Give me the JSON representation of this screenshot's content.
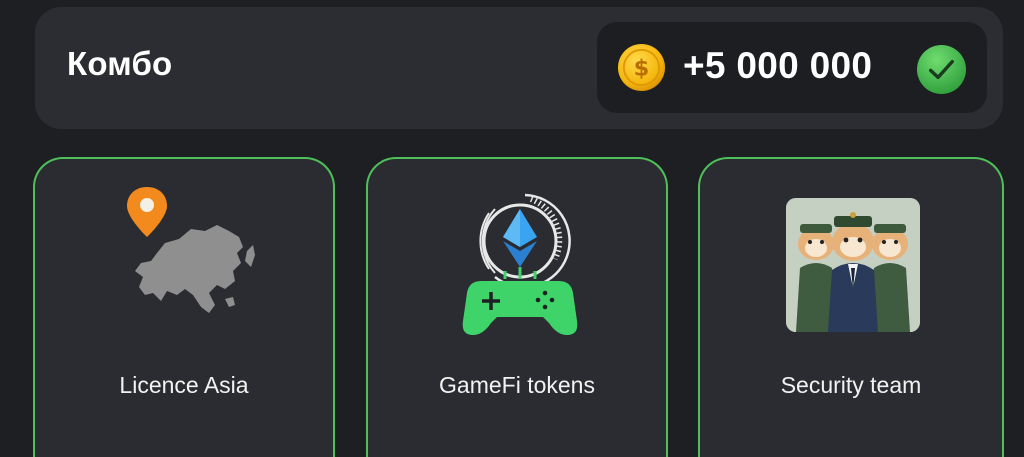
{
  "combo": {
    "title": "Комбо",
    "reward_amount": "+5 000 000",
    "coin_icon": "dollar-coin-icon",
    "status_icon": "check-circle-icon",
    "completed": true
  },
  "cards": [
    {
      "label": "Licence Asia",
      "icon": "asia-map-pin-icon"
    },
    {
      "label": "GameFi tokens",
      "icon": "ethereum-gamepad-icon"
    },
    {
      "label": "Security team",
      "icon": "hamster-guards-image"
    }
  ],
  "colors": {
    "background": "#1d1f22",
    "panel": "#2b2d32",
    "reward_box": "#1c1e21",
    "card_border": "#4fbf5a",
    "coin": "#f5b70f",
    "check": "#3fb64b",
    "gamepad": "#3fd46a",
    "ethereum": "#3aa4f0",
    "pin": "#f28a1e",
    "map_gray": "#8e8e8e"
  }
}
